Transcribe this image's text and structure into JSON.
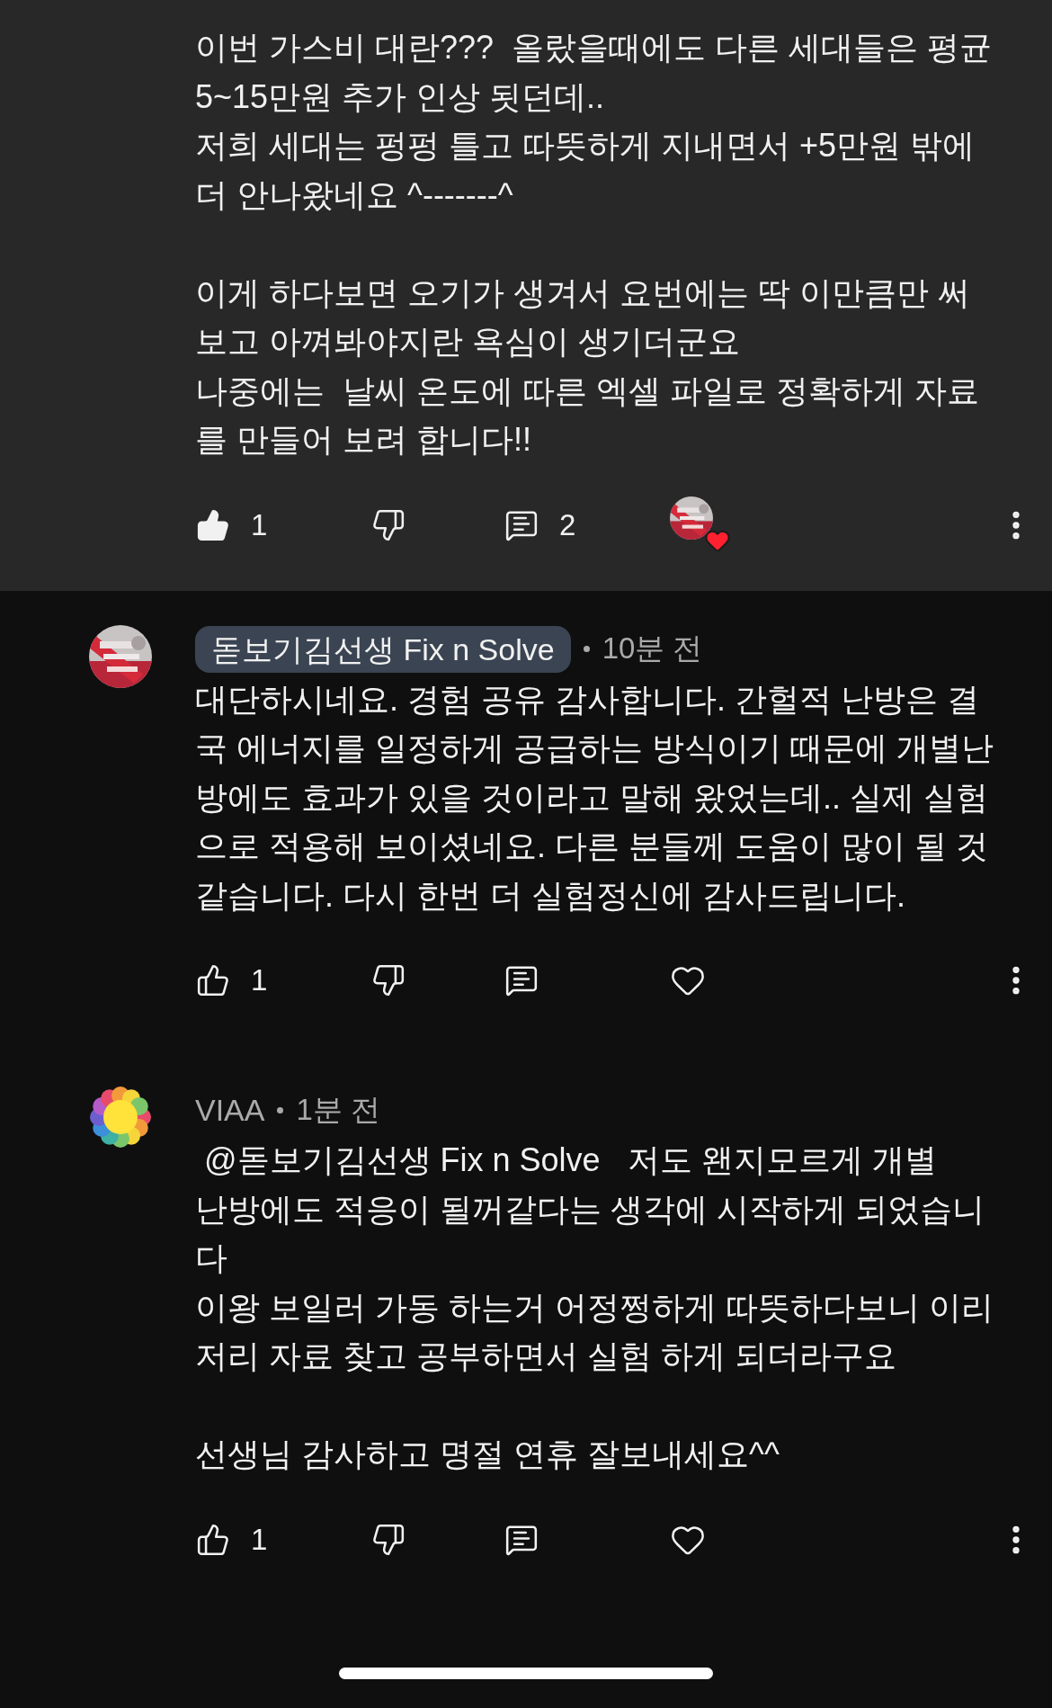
{
  "comments": [
    {
      "kind": "continued",
      "body": "이번 가스비 대란???  올랐을때에도 다른 세대들은 평균\n5~15만원 추가 인상 됫던데..\n저희 세대는 펑펑 틀고 따뜻하게 지내면서 +5만원 밖에\n더 안나왔네요 ^-------^\n\n이게 하다보면 오기가 생겨서 요번에는 딱 이만큼만 써\n보고 아껴봐야지란 욕심이 생기더군요\n나중에는  날씨 온도에 따른 엑셀 파일로 정확하게 자료\n를 만들어 보려 합니다!!",
      "likes": "1",
      "liked": true,
      "replies": "2",
      "hearted": true
    },
    {
      "kind": "comment",
      "author": "돋보기김선생 Fix n Solve",
      "creator": true,
      "time": "10분 전",
      "body": "대단하시네요. 경험 공유 감사합니다. 간헐적 난방은 결\n국 에너지를 일정하게 공급하는 방식이기 때문에 개별난\n방에도 효과가 있을 것이라고 말해 왔었는데.. 실제 실험\n으로 적용해 보이셨네요. 다른 분들께 도움이 많이 될 것\n같습니다. 다시 한번 더 실험정신에 감사드립니다.",
      "likes": "1",
      "liked": false,
      "hearted": false
    },
    {
      "kind": "comment",
      "avatar": {
        "kind": "flower"
      },
      "author": "VIAA",
      "creator": false,
      "time": "1분 전",
      "body": " @돋보기김선생 Fix n Solve   저도 왠지모르게 개별\n난방에도 적응이 될꺼같다는 생각에 시작하게 되었습니\n다\n이왕 보일러 가동 하는거 어정쩡하게 따뜻하다보니 이리\n저리 자료 찾고 공부하면서 실험 하게 되더라구요\n\n선생님 감사하고 명절 연휴 잘보내세요^^",
      "likes": "1",
      "liked": false,
      "hearted": false
    }
  ]
}
